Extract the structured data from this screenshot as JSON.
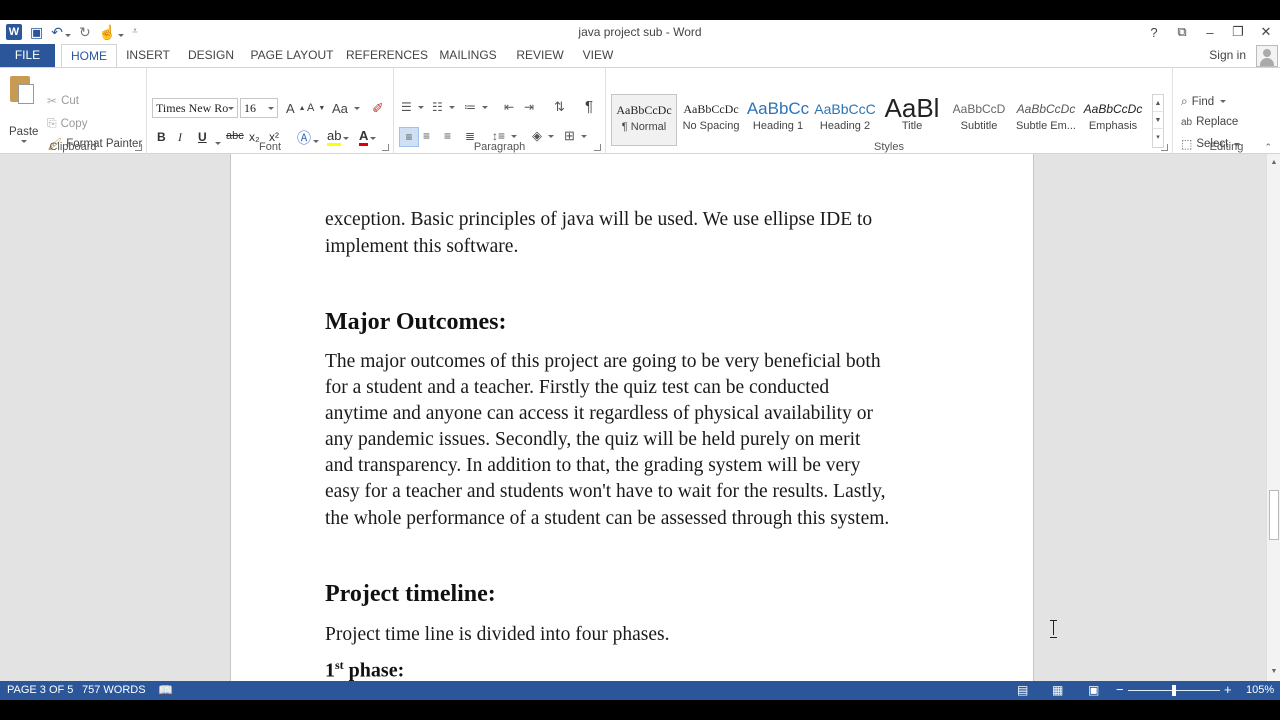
{
  "window": {
    "title": "java project sub - Word"
  },
  "qat": {
    "save": "save-icon",
    "undo": "undo-icon",
    "redo": "redo-icon",
    "touch": "touch-mode-icon",
    "customize": "customize-qat-icon"
  },
  "tabs": [
    "FILE",
    "HOME",
    "INSERT",
    "DESIGN",
    "PAGE LAYOUT",
    "REFERENCES",
    "MAILINGS",
    "REVIEW",
    "VIEW"
  ],
  "account": {
    "signin": "Sign in"
  },
  "clipboard": {
    "paste": "Paste",
    "cut": "Cut",
    "copy": "Copy",
    "format_painter": "Format Painter",
    "label": "Clipboard"
  },
  "font": {
    "name": "Times New Ro",
    "size": "16",
    "bold": "B",
    "italic": "I",
    "underline": "U",
    "strike": "abc",
    "sub": "x₂",
    "sup": "x²",
    "grow": "A",
    "shrink": "A",
    "change_case": "Aa",
    "label": "Font"
  },
  "paragraph": {
    "show_marks": "¶",
    "label": "Paragraph"
  },
  "styles": {
    "label": "Styles",
    "items": [
      {
        "preview": "AaBbCcDc",
        "name": "¶ Normal"
      },
      {
        "preview": "AaBbCcDc",
        "name": "No Spacing"
      },
      {
        "preview": "AaBbCc",
        "name": "Heading 1"
      },
      {
        "preview": "AaBbCcC",
        "name": "Heading 2"
      },
      {
        "preview": "AaBl",
        "name": "Title"
      },
      {
        "preview": "AaBbCcD",
        "name": "Subtitle"
      },
      {
        "preview": "AaBbCcDc",
        "name": "Subtle Em..."
      },
      {
        "preview": "AaBbCcDc",
        "name": "Emphasis"
      }
    ]
  },
  "editing": {
    "find": "Find",
    "replace": "Replace",
    "select": "Select",
    "label": "Editing"
  },
  "document": {
    "para1": [
      "exception. Basic principles of java will be used.  We use ellipse IDE to",
      "implement this software."
    ],
    "heading_outcomes": "Major Outcomes:",
    "para2": [
      "The major outcomes of this project are going to be very beneficial both",
      "for a student and a teacher. Firstly the quiz test can be conducted",
      "anytime and anyone can access it regardless of physical availability or",
      "any pandemic issues.  Secondly, the quiz will be held purely on merit",
      "and transparency. In addition to that, the grading system will be very",
      "easy for a teacher and students won't have to wait for the results. Lastly,",
      "the whole performance of a student can be assessed through this system."
    ],
    "heading_timeline": "Project timeline:",
    "para3": "Project time line is divided into four phases.",
    "phase_num": "1",
    "phase_sup": "st",
    "phase_rest": " phase:"
  },
  "status": {
    "page": "PAGE 3 OF 5",
    "words": "757 WORDS",
    "zoom": "105%"
  }
}
